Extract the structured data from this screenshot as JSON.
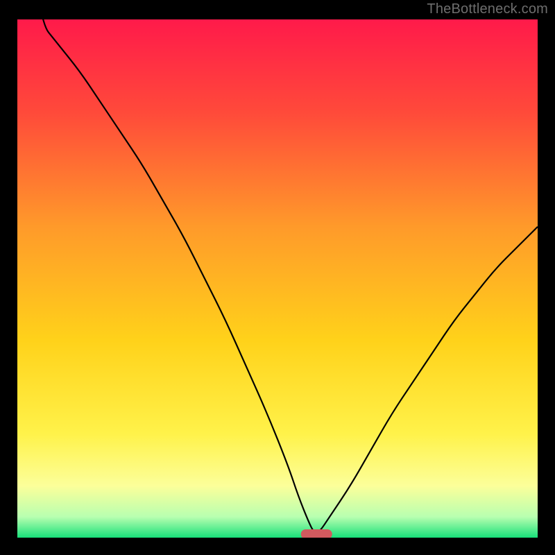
{
  "watermark": "TheBottleneck.com",
  "chart_data": {
    "type": "line",
    "title": "",
    "xlabel": "",
    "ylabel": "",
    "xlim": [
      0,
      100
    ],
    "ylim": [
      0,
      100
    ],
    "grid": false,
    "legend": false,
    "series": [
      {
        "name": "bottleneck-curve",
        "x": [
          0,
          4,
          8,
          12,
          16,
          20,
          24,
          28,
          32,
          36,
          40,
          44,
          48,
          52,
          54,
          56,
          57,
          58,
          60,
          64,
          68,
          72,
          76,
          80,
          84,
          88,
          92,
          96,
          100
        ],
        "y": [
          140,
          100,
          95,
          90,
          84,
          78,
          72,
          65,
          58,
          50,
          42,
          33,
          24,
          14,
          8,
          3,
          1,
          1,
          4,
          10,
          17,
          24,
          30,
          36,
          42,
          47,
          52,
          56,
          60
        ]
      }
    ],
    "gradient_stops": [
      {
        "offset": 0,
        "color": "#ff1a4a"
      },
      {
        "offset": 18,
        "color": "#ff4a3a"
      },
      {
        "offset": 40,
        "color": "#ff9a2a"
      },
      {
        "offset": 62,
        "color": "#ffd21a"
      },
      {
        "offset": 80,
        "color": "#fff24a"
      },
      {
        "offset": 90,
        "color": "#fcff9a"
      },
      {
        "offset": 96,
        "color": "#b8ffb0"
      },
      {
        "offset": 100,
        "color": "#18e07a"
      }
    ],
    "marker": {
      "x_center": 57.5,
      "width": 6,
      "color": "#d25a5f"
    },
    "frame": {
      "outer_size": 800,
      "border": 25,
      "plot_top": 28
    },
    "curve_color": "#000000"
  }
}
